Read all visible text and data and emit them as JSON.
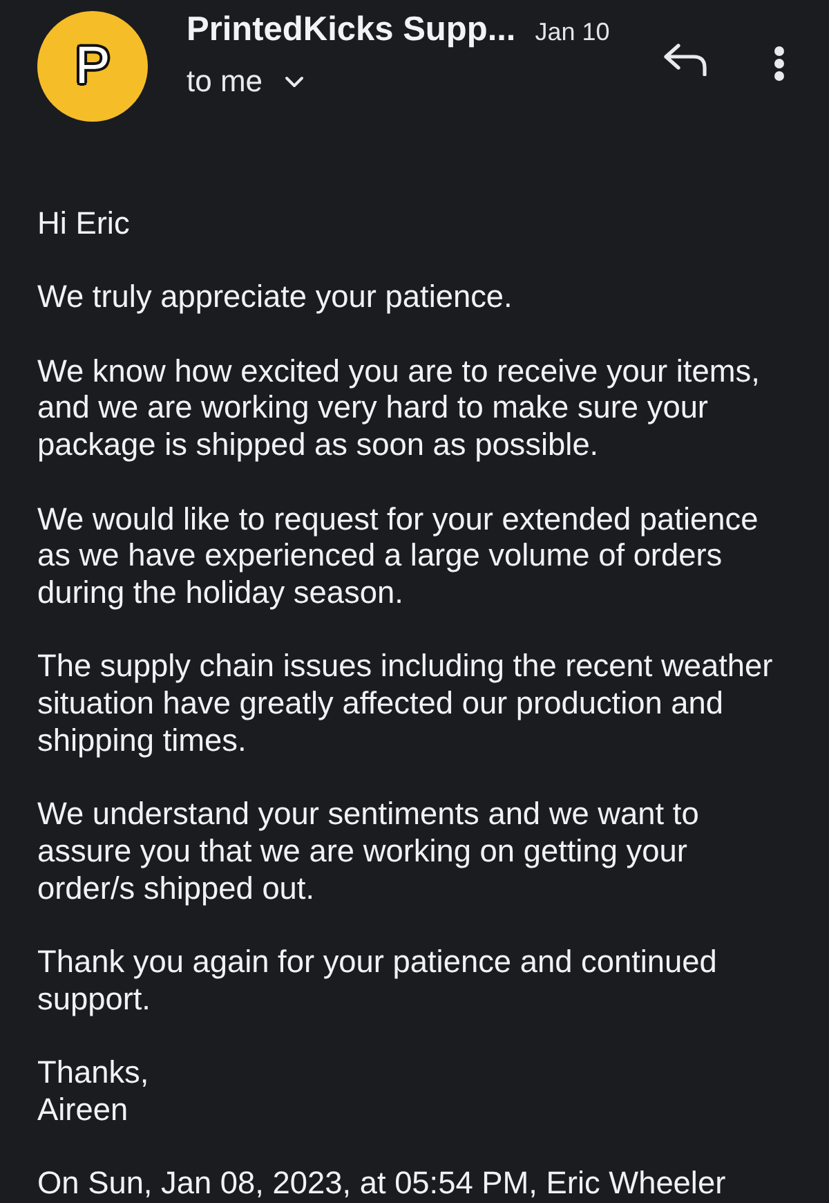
{
  "header": {
    "avatar_letter": "P",
    "sender": "PrintedKicks Supp...",
    "date": "Jan 10",
    "recipient": "to me"
  },
  "body": {
    "paragraphs": [
      "Hi Eric",
      "We truly appreciate your patience.",
      "We know how excited you are to receive your items, and we are working very hard to make sure your package is shipped as soon as possible.",
      "We would like to request for your extended patience as we have experienced a large volume of orders during the holiday season.",
      "The supply chain issues including the recent weather situation have greatly affected our production and shipping times.",
      "We understand your sentiments and we want to assure you that we are working on getting your order/s shipped out.",
      "Thank you again for your patience and continued support."
    ],
    "closing": "Thanks,",
    "signature": "Aireen",
    "quote_header": "On Sun, Jan 08, 2023, at 05:54 PM, Eric Wheeler"
  }
}
